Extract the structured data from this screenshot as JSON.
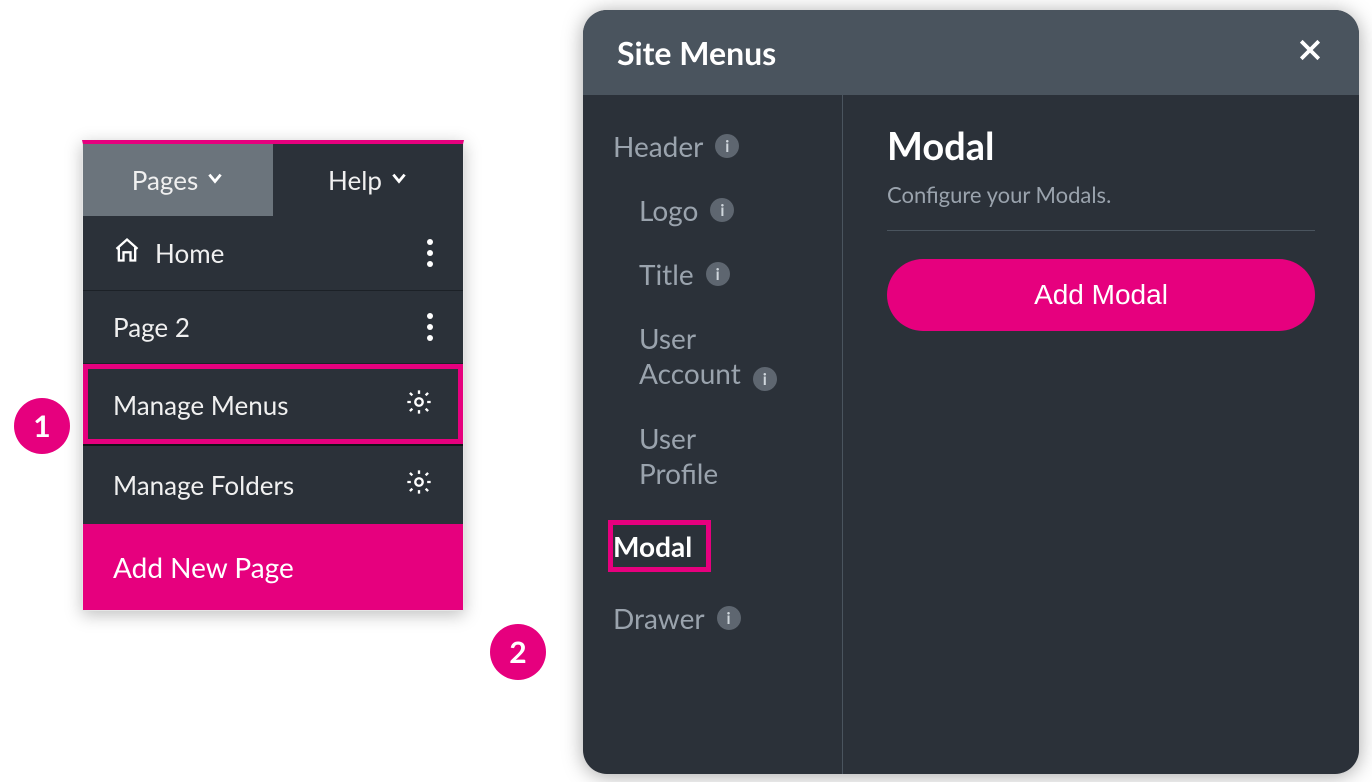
{
  "callouts": {
    "one": "1",
    "two": "2"
  },
  "topbar": {
    "pages": "Pages",
    "help": "Help"
  },
  "pages_list": [
    {
      "label": "Home",
      "has_home_icon": true
    },
    {
      "label": "Page 2",
      "has_home_icon": false
    }
  ],
  "menu_rows": {
    "manage_menus": "Manage Menus",
    "manage_folders": "Manage Folders"
  },
  "add_new_page": "Add New Page",
  "dialog": {
    "title": "Site Menus",
    "sidebar": {
      "header": "Header",
      "logo": "Logo",
      "title_item": "Title",
      "user_account_line1": "User",
      "user_account_line2": "Account",
      "user_profile_line1": "User",
      "user_profile_line2": "Profile",
      "modal": "Modal",
      "drawer": "Drawer"
    },
    "main": {
      "heading": "Modal",
      "subtext": "Configure your Modals.",
      "button": "Add Modal"
    }
  }
}
